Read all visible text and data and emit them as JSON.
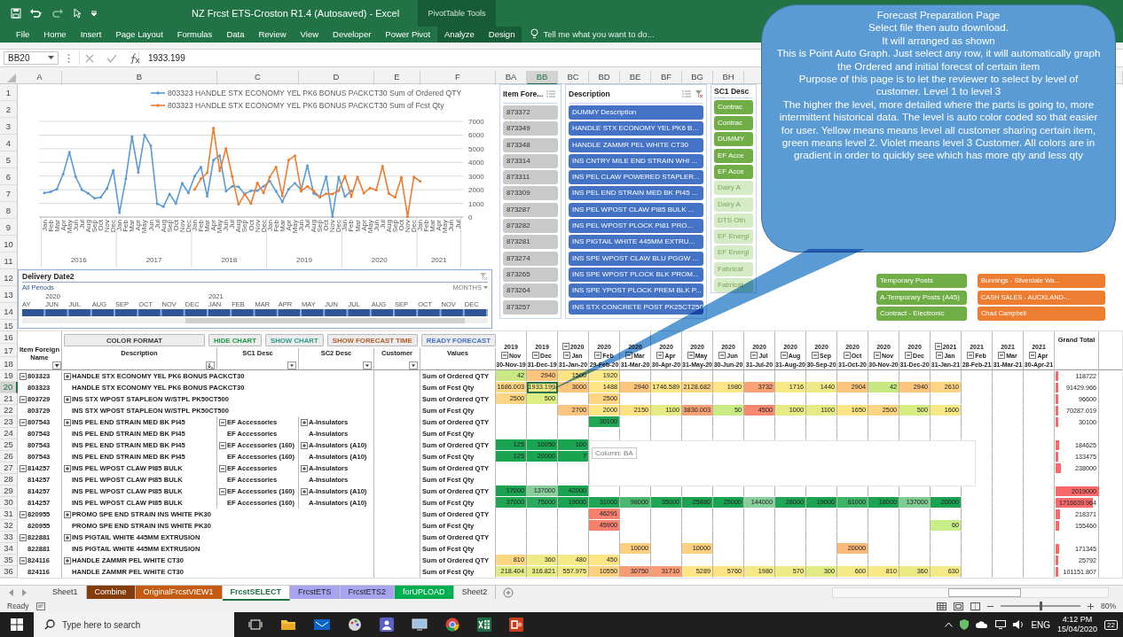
{
  "window": {
    "title": "NZ Frcst ETS-Croston R1.4 (Autosaved) - Excel",
    "context_group": "PivotTable Tools"
  },
  "ribbon_tabs": [
    {
      "label": "File",
      "contextual": false
    },
    {
      "label": "Home",
      "contextual": false
    },
    {
      "label": "Insert",
      "contextual": false
    },
    {
      "label": "Page Layout",
      "contextual": false
    },
    {
      "label": "Formulas",
      "contextual": false
    },
    {
      "label": "Data",
      "contextual": false
    },
    {
      "label": "Review",
      "contextual": false
    },
    {
      "label": "View",
      "contextual": false
    },
    {
      "label": "Developer",
      "contextual": false
    },
    {
      "label": "Power Pivot",
      "contextual": false
    },
    {
      "label": "Analyze",
      "contextual": true
    },
    {
      "label": "Design",
      "contextual": true
    }
  ],
  "tell_me": {
    "placeholder": "Tell me what you want to do..."
  },
  "name_box": "BB20",
  "formula": "1933.199",
  "column_headers": [
    {
      "label": "A",
      "selected": false
    },
    {
      "label": "B",
      "selected": false
    },
    {
      "label": "C",
      "selected": false
    },
    {
      "label": "D",
      "selected": false
    },
    {
      "label": "E",
      "selected": false
    },
    {
      "label": "F",
      "selected": false
    },
    {
      "label": "BA",
      "selected": false
    },
    {
      "label": "BB",
      "selected": true
    },
    {
      "label": "BC",
      "selected": false
    },
    {
      "label": "BD",
      "selected": false
    },
    {
      "label": "BE",
      "selected": false
    },
    {
      "label": "BF",
      "selected": false
    },
    {
      "label": "BG",
      "selected": false
    },
    {
      "label": "BH",
      "selected": false
    }
  ],
  "row_headers": [
    "1",
    "2",
    "3",
    "4",
    "5",
    "6",
    "7",
    "8",
    "9",
    "10",
    "11",
    "12",
    "13",
    "14",
    "15",
    "16",
    "17",
    "18"
  ],
  "chart": {
    "year_labels": [
      "2016",
      "2017",
      "2018",
      "2019",
      "2020",
      "2021"
    ],
    "chart_data": {
      "type": "line",
      "categories": [
        "Jan",
        "Feb",
        "Mar",
        "Apr",
        "May",
        "Jun",
        "Jul",
        "Aug",
        "Sep",
        "Oct",
        "Nov",
        "Dec",
        "Jan",
        "Feb",
        "Mar",
        "Apr",
        "May",
        "Jun",
        "Jul",
        "Aug",
        "Sep",
        "Oct",
        "Nov",
        "Dec",
        "Jan",
        "Feb",
        "Mar",
        "Apr",
        "May",
        "Jun",
        "Jul",
        "Aug",
        "Sep",
        "Oct",
        "Nov",
        "Dec",
        "Jan",
        "Feb",
        "Mar",
        "Apr",
        "May",
        "Jun",
        "Jul",
        "Aug",
        "Sep",
        "Oct",
        "Nov",
        "Dec",
        "Jan",
        "Feb",
        "Mar",
        "Apr",
        "May",
        "Jun",
        "Jul",
        "Aug",
        "Sep",
        "Oct",
        "Nov",
        "Dec",
        "Jan",
        "Feb",
        "Mar",
        "Apr",
        "May",
        "Jun",
        "Jul"
      ],
      "series": [
        {
          "name": "803323 HANDLE STX ECONOMY YEL PK6 BONUS PACKCT30 Sum of Ordered QTY",
          "color": "#5b9bd5",
          "values": [
            1770,
            1840,
            2040,
            3150,
            4750,
            2950,
            2000,
            1740,
            1370,
            1440,
            2090,
            3420,
            320,
            2800,
            5890,
            3280,
            6000,
            5210,
            980,
            760,
            1690,
            990,
            2480,
            1770,
            3000,
            3670,
            1520,
            4170,
            4490,
            1900,
            2250,
            2220,
            1690,
            1930,
            1930,
            2250,
            2620,
            1880,
            1120,
            2040,
            2480,
            2000,
            3760,
            1740,
            1470,
            2960,
            40,
            2940,
            1500,
            1920,
            null,
            null,
            null,
            null,
            null,
            null,
            null,
            null,
            null,
            null,
            null,
            null,
            null,
            null,
            null,
            null,
            null
          ]
        },
        {
          "name": "803323 HANDLE STX ECONOMY YEL PK6 BONUS PACKCT30 Sum of Fcst Qty",
          "color": "#ed7d31",
          "values": [
            null,
            null,
            null,
            null,
            null,
            null,
            null,
            null,
            null,
            null,
            null,
            null,
            null,
            null,
            null,
            null,
            null,
            null,
            null,
            null,
            null,
            null,
            null,
            null,
            2020,
            2800,
            3240,
            6520,
            3370,
            5020,
            2960,
            920,
            1670,
            990,
            2500,
            1770,
            2940,
            3670,
            1540,
            4170,
            4490,
            1900,
            2250,
            1910,
            1450,
            1700,
            1690,
            1930,
            3000,
            1490,
            2940,
            1750,
            2130,
            1980,
            3730,
            1720,
            1440,
            2900,
            40,
            2940,
            2610,
            null,
            null,
            null,
            null,
            null,
            null
          ]
        }
      ],
      "ylim": [
        0,
        7000
      ],
      "yticks": [
        0,
        1000,
        2000,
        3000,
        4000,
        5000,
        6000,
        7000
      ],
      "grid": true,
      "legend": true
    }
  },
  "timeline": {
    "title": "Delivery Date2",
    "filter_label": "All Periods",
    "level_label": "MONTHS",
    "months": [
      {
        "label": "AY"
      },
      {
        "label": "JUN",
        "year": "2020"
      },
      {
        "label": "JUL"
      },
      {
        "label": "AUG"
      },
      {
        "label": "SEP"
      },
      {
        "label": "OCT"
      },
      {
        "label": "NOV"
      },
      {
        "label": "DEC"
      },
      {
        "label": "JAN",
        "year": "2021"
      },
      {
        "label": "FEB"
      },
      {
        "label": "MAR"
      },
      {
        "label": "APR"
      },
      {
        "label": "MAY"
      },
      {
        "label": "JUN"
      },
      {
        "label": "JUL"
      },
      {
        "label": "AUG"
      },
      {
        "label": "SEP"
      },
      {
        "label": "OCT"
      },
      {
        "label": "NOV"
      },
      {
        "label": "DEC"
      }
    ]
  },
  "slicers": [
    {
      "kind": "item",
      "title": "Item Fore...",
      "items": [
        {
          "label": "873372",
          "selected": true
        },
        {
          "label": "873349",
          "selected": true
        },
        {
          "label": "873348",
          "selected": true
        },
        {
          "label": "873314",
          "selected": true
        },
        {
          "label": "873311",
          "selected": true
        },
        {
          "label": "873309",
          "selected": true
        },
        {
          "label": "873287",
          "selected": true
        },
        {
          "label": "873282",
          "selected": true
        },
        {
          "label": "873281",
          "selected": true
        },
        {
          "label": "873274",
          "selected": true
        },
        {
          "label": "873265",
          "selected": true
        },
        {
          "label": "873264",
          "selected": true
        },
        {
          "label": "873257",
          "selected": true
        }
      ]
    },
    {
      "kind": "description",
      "title": "Description",
      "items": [
        {
          "label": "DUMMY Description",
          "selected": true
        },
        {
          "label": "HANDLE STX ECONOMY YEL PK6 B...",
          "selected": true
        },
        {
          "label": "HANDLE ZAMMR PEL WHITE CT30",
          "selected": true
        },
        {
          "label": "INS CNTRY MILE END STRAIN WHI ...",
          "selected": true
        },
        {
          "label": "INS PEL CLAW POWERED STAPLER...",
          "selected": true
        },
        {
          "label": "INS PEL END STRAIN MED BK PI45 ...",
          "selected": true
        },
        {
          "label": "INS PEL WPOST CLAW PI85 BULK ...",
          "selected": true
        },
        {
          "label": "INS PEL WPOST PLOCK PI81 PRO...",
          "selected": true
        },
        {
          "label": "INS PIGTAIL WHITE 445MM EXTRU...",
          "selected": true
        },
        {
          "label": "INS SPE WPOST CLAW BLU PGGW ...",
          "selected": true
        },
        {
          "label": "INS SPE WPOST PLOCK BLK PROM...",
          "selected": true
        },
        {
          "label": "INS SPE YPOST PLOCK PREM BLK P...",
          "selected": true
        },
        {
          "label": "INS STX CONCRETE POST PK25CT250",
          "selected": true
        }
      ]
    },
    {
      "kind": "sc1",
      "title": "SC1 Desc",
      "items": [
        {
          "label": "Contrac",
          "selected": true
        },
        {
          "label": "Contrac",
          "selected": true
        },
        {
          "label": "DUMMY",
          "selected": true
        },
        {
          "label": "EF Acce",
          "selected": true
        },
        {
          "label": "EF Acce",
          "selected": true
        },
        {
          "label": "Dairy A",
          "selected": false
        },
        {
          "label": "Dairy A",
          "selected": false
        },
        {
          "label": "DTS Oth",
          "selected": false
        },
        {
          "label": "EF Energi",
          "selected": false
        },
        {
          "label": "EF Energi",
          "selected": false
        },
        {
          "label": "Fabricat",
          "selected": false
        },
        {
          "label": "Fabricat",
          "selected": false
        }
      ]
    },
    {
      "kind": "sc2",
      "items": [
        {
          "label": "Temporary Posts",
          "selected": true
        },
        {
          "label": "A-Temporary Posts (A45)",
          "selected": true
        },
        {
          "label": "Contract - Electronic",
          "selected": true
        }
      ]
    },
    {
      "kind": "customer",
      "items": [
        {
          "label": "Bunnings - Silverdale Wa...",
          "selected": true
        },
        {
          "label": "CASH SALES - AUCKLAND-...",
          "selected": true
        },
        {
          "label": "Chad Campbell",
          "selected": true
        }
      ]
    }
  ],
  "buttons": [
    {
      "label": "COLOR FORMAT",
      "color": "#3b3b3b"
    },
    {
      "label": "HIDE CHART",
      "color": "#1e9a4a"
    },
    {
      "label": "SHOW CHART",
      "color": "#2e9c8c"
    },
    {
      "label": "SHOW FORECAST TIME",
      "color": "#b0602c"
    },
    {
      "label": "READY FORECAST",
      "color": "#4472c4"
    }
  ],
  "pivot_headers": {
    "item": "Item Foreign Name",
    "description": "Description",
    "sc1": "SC1 Desc",
    "sc2": "SC2 Desc",
    "customer": "Customer",
    "values": "Values",
    "grand_total": "Grand Total"
  },
  "date_columns": [
    {
      "year": "2019",
      "year_toggle": false,
      "month": "Nov",
      "date": "30-Nov-19"
    },
    {
      "year": "2019",
      "year_toggle": false,
      "month": "Dec",
      "date": "31-Dec-19"
    },
    {
      "year": "2020",
      "year_toggle": true,
      "month": "Jan",
      "date": "31-Jan-20"
    },
    {
      "year": "2020",
      "year_toggle": false,
      "month": "Feb",
      "date": "29-Feb-20"
    },
    {
      "year": "2020",
      "year_toggle": false,
      "month": "Mar",
      "date": "31-Mar-20"
    },
    {
      "year": "2020",
      "year_toggle": false,
      "month": "Apr",
      "date": "30-Apr-20"
    },
    {
      "year": "2020",
      "year_toggle": false,
      "month": "May",
      "date": "31-May-20"
    },
    {
      "year": "2020",
      "year_toggle": false,
      "month": "Jun",
      "date": "30-Jun-20"
    },
    {
      "year": "2020",
      "year_toggle": false,
      "month": "Jul",
      "date": "31-Jul-20"
    },
    {
      "year": "2020",
      "year_toggle": false,
      "month": "Aug",
      "date": "31-Aug-20"
    },
    {
      "year": "2020",
      "year_toggle": false,
      "month": "Sep",
      "date": "30-Sep-20"
    },
    {
      "year": "2020",
      "year_toggle": false,
      "month": "Oct",
      "date": "31-Oct-20"
    },
    {
      "year": "2020",
      "year_toggle": false,
      "month": "Nov",
      "date": "30-Nov-20"
    },
    {
      "year": "2020",
      "year_toggle": false,
      "month": "Dec",
      "date": "31-Dec-20"
    },
    {
      "year": "2021",
      "year_toggle": true,
      "month": "Jan",
      "date": "31-Jan-21"
    },
    {
      "year": "2021",
      "year_toggle": false,
      "month": "Feb",
      "date": "28-Feb-21"
    },
    {
      "year": "2021",
      "year_toggle": false,
      "month": "Mar",
      "date": "31-Mar-21"
    },
    {
      "year": "2021",
      "year_toggle": false,
      "month": "Apr",
      "date": "30-Apr-21"
    }
  ],
  "rows": [
    {
      "row": "19",
      "selected": false,
      "item": "803323",
      "item_expanded": true,
      "desc": "HANDLE STX ECONOMY YEL PK6 BONUS PACKCT30",
      "desc_expanded": false,
      "values": "Sum of Ordered QTY",
      "cells": [
        {
          "text": "42",
          "color": "#c9e883",
          "selected": false
        },
        {
          "text": "2940",
          "color": "#fcc47c",
          "selected": false
        },
        {
          "text": "1500",
          "color": "#fde483",
          "selected": false
        },
        {
          "text": "1920",
          "color": "#fee88c",
          "selected": false
        },
        null,
        null,
        null,
        null,
        null,
        null,
        null,
        null,
        null,
        null,
        null,
        null,
        null,
        null
      ],
      "total": "118722",
      "level": 0.06
    },
    {
      "row": "20",
      "selected": true,
      "item": "803323",
      "desc": "HANDLE STX ECONOMY YEL PK6 BONUS PACKCT30",
      "values": "Sum of Fcst Qty",
      "cells": [
        {
          "text": "1686.003",
          "color": "#fdd683",
          "selected": false
        },
        {
          "text": "1933.199",
          "color": "#f2e884",
          "selected": true
        },
        {
          "text": "3000",
          "color": "#fcc37c",
          "selected": false
        },
        {
          "text": "1488",
          "color": "#fde585",
          "selected": false
        },
        {
          "text": "2940",
          "color": "#fcc47c",
          "selected": false
        },
        {
          "text": "1746.589",
          "color": "#fde484",
          "selected": false
        },
        {
          "text": "2128.682",
          "color": "#fdd582",
          "selected": false
        },
        {
          "text": "1980",
          "color": "#fde585",
          "selected": false
        },
        {
          "text": "3732",
          "color": "#f8a275",
          "selected": false
        },
        {
          "text": "1716",
          "color": "#f6e985",
          "selected": false
        },
        {
          "text": "1440",
          "color": "#eee985",
          "selected": false
        },
        {
          "text": "2904",
          "color": "#fcc47c",
          "selected": false
        },
        {
          "text": "42",
          "color": "#c8e883",
          "selected": false
        },
        {
          "text": "2940",
          "color": "#fcc47c",
          "selected": false
        },
        {
          "text": "2610",
          "color": "#fdd582",
          "selected": false
        },
        null,
        null,
        null
      ],
      "total": "91429.966",
      "level": 0.045
    },
    {
      "row": "21",
      "selected": false,
      "item": "803729",
      "item_expanded": true,
      "desc": "INS STX WPOST STAPLEON W/STPL PK50CT500",
      "desc_expanded": false,
      "values": "Sum of Ordered QTY",
      "cells": [
        {
          "text": "2500",
          "color": "#fdd582",
          "selected": false
        },
        {
          "text": "500",
          "color": "#dcef84",
          "selected": false
        },
        null,
        {
          "text": "2500",
          "color": "#fdd582",
          "selected": false
        },
        null,
        null,
        null,
        null,
        null,
        null,
        null,
        null,
        null,
        null,
        null,
        null,
        null,
        null
      ],
      "total": "96600",
      "level": 0.048
    },
    {
      "row": "22",
      "selected": false,
      "item": "803729",
      "desc": "INS STX WPOST STAPLEON W/STPL PK50CT500",
      "values": "Sum of Fcst Qty",
      "cells": [
        null,
        null,
        {
          "text": "2700",
          "color": "#fcc47c",
          "selected": false
        },
        {
          "text": "2000",
          "color": "#fde585",
          "selected": false
        },
        {
          "text": "2150",
          "color": "#fde283",
          "selected": false
        },
        {
          "text": "1100",
          "color": "#e6ea84",
          "selected": false
        },
        {
          "text": "3830.003",
          "color": "#f8a275",
          "selected": false
        },
        {
          "text": "50",
          "color": "#c8eb84",
          "selected": false
        },
        {
          "text": "4500",
          "color": "#f8896f",
          "selected": false
        },
        {
          "text": "1000",
          "color": "#e6ea84",
          "selected": false
        },
        {
          "text": "1100",
          "color": "#e6ea84",
          "selected": false
        },
        {
          "text": "1650",
          "color": "#fde484",
          "selected": false
        },
        {
          "text": "2500",
          "color": "#fdd582",
          "selected": false
        },
        {
          "text": "500",
          "color": "#d8ec84",
          "selected": false
        },
        {
          "text": "1600",
          "color": "#f6e985",
          "selected": false
        },
        null,
        null,
        null
      ],
      "total": "70287.019",
      "level": 0.035
    },
    {
      "row": "23",
      "selected": false,
      "item": "807543",
      "item_expanded": true,
      "desc": "INS PEL END STRAIN MED BK PI45",
      "desc_expanded": false,
      "sc1": "EF Accessories",
      "sc1_expanded": true,
      "sc2": "A-Insulators",
      "sc2_expanded": false,
      "values": "Sum of Ordered QTY",
      "cells": [
        null,
        null,
        null,
        {
          "text": "30100",
          "color": "#21a656",
          "selected": false
        },
        null,
        null,
        null,
        null,
        null,
        null,
        null,
        null,
        null,
        null,
        null,
        null,
        null,
        null
      ],
      "total": "30100",
      "level": 0.015
    },
    {
      "row": "24",
      "selected": false,
      "item": "807543",
      "desc": "INS PEL END STRAIN MED BK PI45",
      "sc1": "EF Accessories",
      "sc2": "A-Insulators",
      "values": "Sum of Fcst Qty"
    },
    {
      "row": "25",
      "selected": false,
      "item": "807543",
      "desc": "INS PEL END STRAIN MED BK PI45",
      "sc1": "EF Accessories (160)",
      "sc1_expanded": true,
      "sc2": "A-Insulators (A10)",
      "sc2_expanded": false,
      "values": "Sum of Ordered QTY",
      "cells": [
        {
          "text": "125",
          "color": "#1aa351",
          "selected": false
        },
        {
          "text": "10050",
          "color": "#1aa351",
          "selected": false
        },
        {
          "text": "100",
          "color": "#1aa351",
          "selected": false
        },
        null,
        null,
        null,
        null,
        null,
        null,
        null,
        null,
        null,
        null,
        null,
        null,
        null,
        null,
        null
      ],
      "total": "184625",
      "level": 0.09
    },
    {
      "row": "26",
      "selected": false,
      "item": "807543",
      "desc": "INS PEL END STRAIN MED BK PI45",
      "sc1": "EF Accessories (160)",
      "sc2": "A-Insulators (A10)",
      "values": "Sum of Fcst Qty",
      "cells": [
        {
          "text": "125",
          "color": "#1aa351",
          "selected": false
        },
        {
          "text": "20000",
          "color": "#1aa351",
          "selected": false
        },
        {
          "text": "7",
          "color": "#1aa351",
          "selected": false
        },
        null,
        null,
        null,
        null,
        null,
        null,
        null,
        null,
        null,
        null,
        null,
        null,
        null,
        null,
        null
      ],
      "total": "133475",
      "level": 0.066
    },
    {
      "row": "27",
      "selected": false,
      "item": "814257",
      "item_expanded": true,
      "desc": "INS PEL WPOST CLAW PI85 BULK",
      "desc_expanded": false,
      "sc1": "EF Accessories",
      "sc1_expanded": true,
      "sc2": "A-Insulators",
      "sc2_expanded": false,
      "values": "Sum of Ordered QTY",
      "total": "238000",
      "level": 0.118
    },
    {
      "row": "28",
      "selected": false,
      "item": "814257",
      "desc": "INS PEL WPOST CLAW PI85 BULK",
      "sc1": "EF Accessories",
      "sc2": "A-Insulators",
      "values": "Sum of Fcst Qty"
    },
    {
      "row": "29",
      "selected": false,
      "item": "814257",
      "desc": "INS PEL WPOST CLAW PI85 BULK",
      "sc1": "EF Accessories (160)",
      "sc1_expanded": true,
      "sc2": "A-Insulators (A10)",
      "sc2_expanded": false,
      "values": "Sum of Ordered QTY",
      "cells": [
        {
          "text": "17000",
          "color": "#1aa351",
          "selected": false
        },
        {
          "text": "137000",
          "color": "#86cf9a",
          "selected": false
        },
        {
          "text": "42000",
          "color": "#1aa351",
          "selected": false
        },
        null,
        null,
        null,
        null,
        null,
        null,
        null,
        null,
        null,
        null,
        null,
        null,
        null,
        null,
        null
      ],
      "total": "2019000",
      "level": 1
    },
    {
      "row": "30",
      "selected": false,
      "item": "814257",
      "desc": "INS PEL WPOST CLAW PI85 BULK",
      "sc1": "EF Accessories (160)",
      "sc2": "A-Insulators (A10)",
      "values": "Sum of Fcst Qty",
      "cells": [
        {
          "text": "37000",
          "color": "#1ea655",
          "selected": false
        },
        {
          "text": "75000",
          "color": "#2aaa5c",
          "selected": false
        },
        {
          "text": "19000",
          "color": "#1aa351",
          "selected": false
        },
        {
          "text": "31000",
          "color": "#1fa654",
          "selected": false
        },
        {
          "text": "98000",
          "color": "#4cb771",
          "selected": false
        },
        {
          "text": "35000",
          "color": "#1ea655",
          "selected": false
        },
        {
          "text": "25880",
          "color": "#1aa351",
          "selected": false
        },
        {
          "text": "25000",
          "color": "#1aa351",
          "selected": false
        },
        {
          "text": "144000",
          "color": "#87cf9b",
          "selected": false
        },
        {
          "text": "28000",
          "color": "#1ea655",
          "selected": false
        },
        {
          "text": "19000",
          "color": "#1aa351",
          "selected": false
        },
        {
          "text": "61000",
          "color": "#3cb367",
          "selected": false
        },
        {
          "text": "18000",
          "color": "#1aa351",
          "selected": false
        },
        {
          "text": "137000",
          "color": "#7ecb94",
          "selected": false
        },
        {
          "text": "20000",
          "color": "#1aa351",
          "selected": false
        },
        null,
        null,
        null
      ],
      "total": "1716639.964",
      "level": 0.85
    },
    {
      "row": "31",
      "selected": false,
      "item": "820955",
      "item_expanded": true,
      "desc": "PROMO SPE END STRAIN INS WHITE PK30",
      "desc_expanded": false,
      "values": "Sum of Ordered QTY",
      "cells": [
        null,
        null,
        null,
        {
          "text": "46291",
          "color": "#f8806f",
          "selected": false
        },
        null,
        null,
        null,
        null,
        null,
        null,
        null,
        null,
        null,
        null,
        null,
        null,
        null,
        null
      ],
      "total": "218371",
      "level": 0.108
    },
    {
      "row": "32",
      "selected": false,
      "item": "820955",
      "desc": "PROMO SPE END STRAIN INS WHITE PK30",
      "values": "Sum of Fcst Qty",
      "cells": [
        null,
        null,
        null,
        {
          "text": "45900",
          "color": "#f8806f",
          "selected": false
        },
        null,
        null,
        null,
        null,
        null,
        null,
        null,
        null,
        null,
        null,
        {
          "text": "60",
          "color": "#c8ef87",
          "selected": false
        },
        null,
        null,
        null
      ],
      "total": "155460",
      "level": 0.077
    },
    {
      "row": "33",
      "selected": false,
      "item": "822881",
      "item_expanded": true,
      "desc": "INS PIGTAIL WHITE 445MM EXTRUSION",
      "desc_expanded": false,
      "values": "Sum of Ordered QTY"
    },
    {
      "row": "34",
      "selected": false,
      "item": "822881",
      "desc": "INS PIGTAIL WHITE 445MM EXTRUSION",
      "values": "Sum of Fcst Qty",
      "cells": [
        null,
        null,
        null,
        null,
        {
          "text": "10000",
          "color": "#fdd07f",
          "selected": false
        },
        null,
        {
          "text": "10000",
          "color": "#fdd07f",
          "selected": false
        },
        null,
        null,
        null,
        null,
        {
          "text": "20000",
          "color": "#fcb97a",
          "selected": false
        },
        null,
        null,
        null,
        null,
        null,
        null
      ],
      "total": "171345",
      "level": 0.085
    },
    {
      "row": "35",
      "selected": false,
      "item": "824116",
      "item_expanded": true,
      "desc": "HANDLE ZAMMR PEL WHITE CT30",
      "desc_expanded": false,
      "values": "Sum of Ordered QTY",
      "cells": [
        {
          "text": "810",
          "color": "#fdd682",
          "selected": false
        },
        {
          "text": "360",
          "color": "#eeea85",
          "selected": false
        },
        {
          "text": "480",
          "color": "#f5e985",
          "selected": false
        },
        {
          "text": "450",
          "color": "#fde484",
          "selected": false
        },
        null,
        null,
        null,
        null,
        null,
        null,
        null,
        null,
        null,
        null,
        null,
        null,
        null,
        null
      ],
      "total": "25792",
      "level": 0.013
    },
    {
      "row": "36",
      "selected": false,
      "item": "824116",
      "desc": "HANDLE ZAMMR PEL WHITE CT30",
      "values": "Sum of Fcst Qty",
      "cells": [
        {
          "text": "218.404",
          "color": "#e1ec84",
          "selected": false
        },
        {
          "text": "316.821",
          "color": "#e9eb84",
          "selected": false
        },
        {
          "text": "557.975",
          "color": "#f2ea84",
          "selected": false
        },
        {
          "text": "10550",
          "color": "#fdd07f",
          "selected": false
        },
        {
          "text": "30750",
          "color": "#f79a76",
          "selected": false
        },
        {
          "text": "31710",
          "color": "#f99b76",
          "selected": false
        },
        {
          "text": "5289",
          "color": "#fde484",
          "selected": false
        },
        {
          "text": "5760",
          "color": "#fde384",
          "selected": false
        },
        {
          "text": "1980",
          "color": "#f4e985",
          "selected": false
        },
        {
          "text": "570",
          "color": "#eeea85",
          "selected": false
        },
        {
          "text": "300",
          "color": "#e1ec84",
          "selected": false
        },
        {
          "text": "600",
          "color": "#f4e985",
          "selected": false
        },
        {
          "text": "810",
          "color": "#f9e985",
          "selected": false
        },
        {
          "text": "360",
          "color": "#ecea85",
          "selected": false
        },
        {
          "text": "630",
          "color": "#f5e985",
          "selected": false
        },
        null,
        null,
        null
      ],
      "total": "101151.807",
      "level": 0.05
    }
  ],
  "callout": {
    "paragraphs": [
      "Forecast Preparation Page",
      "Select file then auto download.",
      "It will arranged as shown",
      "This is Point Auto Graph.  Just select any row, it will automatically graph the Ordered and initial forecst of certain item",
      "Purpose of this page is to let the reviewer to select by level of customer.  Level 1 to level 3",
      "The higher the level, more detailed where the parts is going to,  more intermittent historical data.  The level is auto color coded so that easier for user.   Yellow means means level all customer sharing certain item,  green means level 2.  Violet means level 3 Customer.  All colors are in gradient  in order to quickly see which has more qty and less qty"
    ]
  },
  "tooltip": {
    "label": "Column: BA"
  },
  "sheet_tabs": [
    {
      "label": "Sheet1",
      "selected": false
    },
    {
      "label": "Combine",
      "selected": false,
      "color": "#843c0c"
    },
    {
      "label": "OriginalFrcstVIEW1",
      "selected": false,
      "color": "#c55a11"
    },
    {
      "label": "FrcstSELECT",
      "selected": true
    },
    {
      "label": "FrcstETS",
      "selected": false,
      "color": "#a9a4f0"
    },
    {
      "label": "FrcstETS2",
      "selected": false,
      "color": "#a9a4f0"
    },
    {
      "label": "forUPLOAD",
      "selected": false,
      "color": "#00b050"
    },
    {
      "label": "Sheet2",
      "selected": false
    }
  ],
  "status_bar": {
    "mode": "Ready",
    "zoom": "80%",
    "level": 0.5
  },
  "taskbar": {
    "search": {
      "placeholder": "Type here to search"
    },
    "language": "ENG",
    "time": "4:12 PM",
    "date": "15/04/2020",
    "notifications": "22"
  }
}
